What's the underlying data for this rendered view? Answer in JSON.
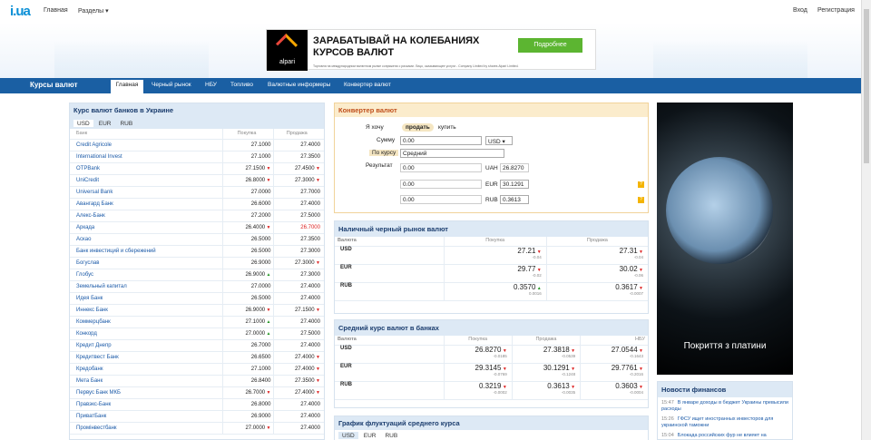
{
  "header": {
    "logo": "i.ua",
    "nav": [
      "Главная",
      "Разделы ▾"
    ],
    "right": [
      "Вход",
      "Регистрация"
    ]
  },
  "ad": {
    "brand": "alpari",
    "headline": "ЗАРАБАТЫВАЙ НА КОЛЕБАНИЯХ КУРСОВ ВАЛЮТ",
    "button": "Подробнее",
    "fine": "Торговля на международном валютном рынке сопряжена с рисками. Лицо, оказывающее услуги - Company Limited by shares Alpari Limited."
  },
  "section_title": "Курсы валют",
  "tabs": [
    "Главная",
    "Черный рынок",
    "НБУ",
    "Топливо",
    "Валютные информеры",
    "Конвертер валют"
  ],
  "banks": {
    "title": "Курс валют банков в Украине",
    "currencies": [
      "USD",
      "EUR",
      "RUB"
    ],
    "cols": [
      "Банк",
      "Покупка",
      "Продажа"
    ],
    "rows": [
      [
        "Credit Agricole",
        "27.1000",
        "",
        "27.4000",
        ""
      ],
      [
        "International Invest",
        "27.1000",
        "",
        "27.3500",
        ""
      ],
      [
        "OTPBank",
        "27.1500",
        "dn",
        "27.4500",
        "dn"
      ],
      [
        "UniCredit",
        "26.8000",
        "dn",
        "27.3000",
        "dn"
      ],
      [
        "Universal Bank",
        "27.0000",
        "",
        "27.7000",
        ""
      ],
      [
        "Авангард Банк",
        "26.6000",
        "",
        "27.4000",
        ""
      ],
      [
        "Алекс-Банк",
        "27.2000",
        "",
        "27.5000",
        ""
      ],
      [
        "Аркада",
        "26.4000",
        "dn",
        "26.7000",
        "red"
      ],
      [
        "Аскао",
        "26.5000",
        "",
        "27.3500",
        ""
      ],
      [
        "Банк инвестиций и сбережений",
        "26.5000",
        "",
        "27.3000",
        ""
      ],
      [
        "Богуслав",
        "26.9000",
        "",
        "27.3000",
        "dn"
      ],
      [
        "Глобус",
        "26.9000",
        "up",
        "27.3000",
        ""
      ],
      [
        "Земельный капитал",
        "27.0000",
        "",
        "27.4000",
        ""
      ],
      [
        "Идея Банк",
        "26.5000",
        "",
        "27.4000",
        ""
      ],
      [
        "Иннекс Банк",
        "26.9000",
        "dn",
        "27.1500",
        "dn"
      ],
      [
        "Коммерцбанк",
        "27.1000",
        "up",
        "27.4000",
        ""
      ],
      [
        "Конкорд",
        "27.0000",
        "up",
        "27.5000",
        ""
      ],
      [
        "Кредит Днепр",
        "26.7000",
        "",
        "27.4000",
        ""
      ],
      [
        "Кредитвест Банк",
        "26.6500",
        "",
        "27.4000",
        "dn"
      ],
      [
        "Кредобанк",
        "27.1000",
        "",
        "27.4000",
        "dn"
      ],
      [
        "Мета Банк",
        "26.8400",
        "",
        "27.3500",
        "dn"
      ],
      [
        "Первус Банк МКБ",
        "26.7000",
        "dn",
        "27.4000",
        "dn"
      ],
      [
        "Правэкс-Банк",
        "26.8000",
        "",
        "27.4000",
        ""
      ],
      [
        "ПриватБанк",
        "26.9000",
        "",
        "27.4000",
        ""
      ],
      [
        "Промінвестбанк",
        "27.0000",
        "dn",
        "27.4000",
        ""
      ]
    ]
  },
  "converter": {
    "title": "Конвертер валют",
    "want": "Я хочу",
    "sell": "продать",
    "buy": "купить",
    "sum_label": "Сумму",
    "sum": "0.00",
    "sum_cur": "USD ▾",
    "rate_label": "По курсу",
    "rate": "Средний",
    "result_label": "Результат",
    "results": [
      {
        "val": "0.00",
        "cur": "UAH",
        "rate": "26.8270"
      },
      {
        "val": "0.00",
        "cur": "EUR",
        "rate": "30.1291"
      },
      {
        "val": "0.00",
        "cur": "RUB",
        "rate": "0.3613"
      }
    ]
  },
  "black": {
    "title": "Наличный черный рынок валют",
    "cols": [
      "Валюта",
      "Покупка",
      "Продажа"
    ],
    "rows": [
      [
        "USD",
        "27.21",
        "dn",
        "-0.04",
        "27.31",
        "dn",
        "-0.04"
      ],
      [
        "EUR",
        "29.77",
        "dn",
        "-0.02",
        "30.02",
        "dn",
        "-0.06"
      ],
      [
        "RUB",
        "0.3570",
        "up",
        "0.0016",
        "0.3617",
        "dn",
        "-0.0007"
      ]
    ]
  },
  "avg": {
    "title": "Средний курс валют в банках",
    "cols": [
      "Валюта",
      "Покупка",
      "Продажа",
      "НБУ"
    ],
    "rows": [
      [
        "USD",
        "26.8270",
        "dn",
        "-0.0185",
        "27.3818",
        "dn",
        "-0.0539",
        "27.0544",
        "dn",
        "-0.1643"
      ],
      [
        "EUR",
        "29.3145",
        "dn",
        "-0.0769",
        "30.1291",
        "dn",
        "-0.1248",
        "29.7761",
        "dn",
        "-0.2016"
      ],
      [
        "RUB",
        "0.3219",
        "dn",
        "-0.0002",
        "0.3613",
        "dn",
        "-0.0035",
        "0.3603",
        "dn",
        "-0.0004"
      ]
    ]
  },
  "chart": {
    "title": "График флуктуаций среднего курса",
    "currencies": [
      "USD",
      "EUR",
      "RUB"
    ]
  },
  "side_ad": {
    "caption": "Покриття з платини"
  },
  "news": {
    "title": "Новости финансов",
    "items": [
      [
        "15:47",
        "В январе доходы в бюджет Украины превысили расходы"
      ],
      [
        "15:26",
        "ГФСУ ищет иностранных инвесторов для украинской таможни"
      ],
      [
        "15:04",
        "Блокада российских фур не влияет на"
      ]
    ]
  }
}
